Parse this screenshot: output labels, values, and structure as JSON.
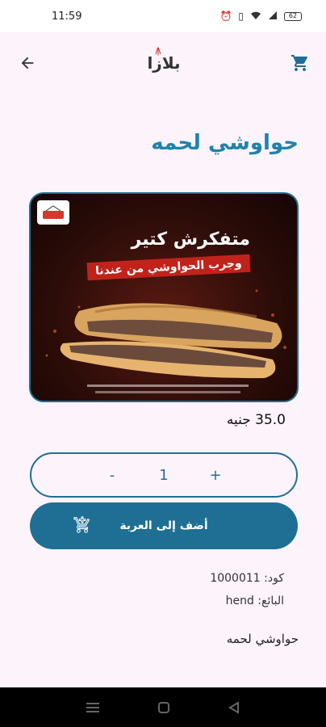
{
  "status_bar": {
    "time": "11:59",
    "battery": "62",
    "icons": [
      "alarm-icon",
      "vibrate-icon",
      "wifi-icon",
      "signal-icon"
    ]
  },
  "app_bar": {
    "logo_text": "بلازا",
    "back_icon": "arrow-left-icon",
    "cart_icon": "cart-icon"
  },
  "product": {
    "title": "حواوشي لحمه",
    "image": {
      "headline": "متفكرش كتير",
      "banner": "وجرب الحواوشي من عندنا"
    },
    "price_label": "35.0 جنيه",
    "quantity": "1",
    "decrement": "-",
    "increment": "+",
    "add_to_cart": "أضف إلى العربة",
    "code_line": "كود: 1000011",
    "seller_line": "البائع: hend",
    "description": "حواوشي لحمه"
  },
  "colors": {
    "primary": "#1f6f94",
    "title": "#1f83ac",
    "background": "#fcf3fb"
  }
}
